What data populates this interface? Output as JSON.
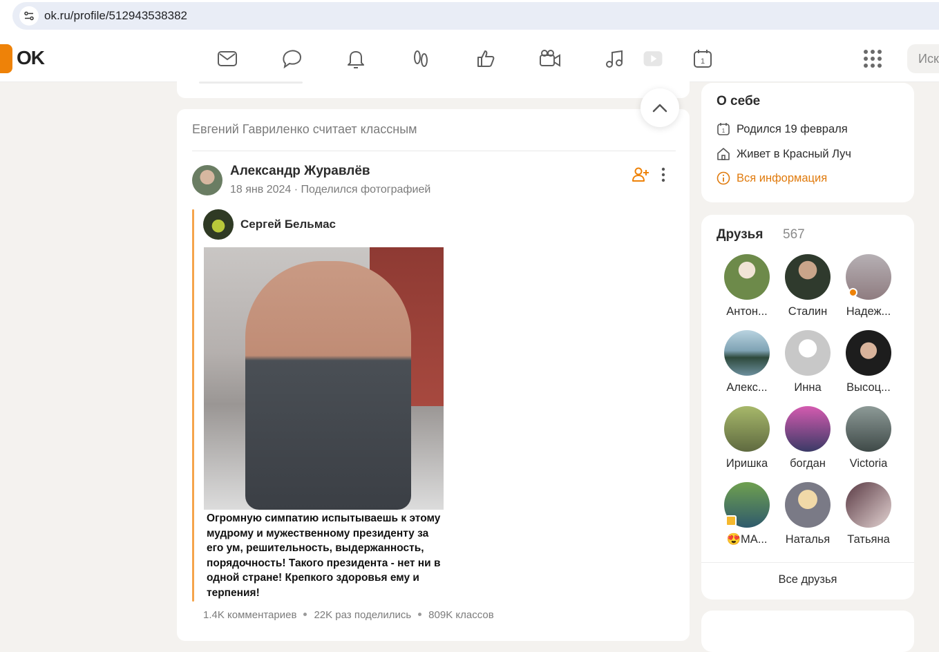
{
  "browser": {
    "url": "ok.ru/profile/512943538382"
  },
  "header": {
    "logo_text": "OK",
    "nav_icons": [
      "mail-icon",
      "discussions-icon",
      "notifications-icon",
      "guests-icon",
      "likes-icon",
      "video-call-icon",
      "music-icon",
      "video-icon",
      "calendar-icon"
    ],
    "search_placeholder": "Иск"
  },
  "feed": {
    "header": "Евгений Гавриленко считает классным",
    "post": {
      "author": "Александр Журавлёв",
      "date": "18 янв 2024",
      "action": "Поделился фотографией",
      "repost_author": "Сергей Бельмас",
      "caption": "Огромную симпатию испытываешь к этому мудрому и мужественному президенту за его ум, решительность, выдержанность, порядочность! Такого президента - нет ни в одной стране! Крепкого здоровья ему и терпения!",
      "stats": {
        "comments": "1.4K комментариев",
        "shares": "22K раз поделились",
        "likes": "809K классов"
      }
    }
  },
  "about": {
    "title": "О себе",
    "birthday": "Родился 19 февраля",
    "city": "Живет в Красный Луч",
    "all_info": "Вся информация"
  },
  "friends": {
    "title": "Друзья",
    "count": "567",
    "list": [
      {
        "name": "Антон..."
      },
      {
        "name": "Сталин"
      },
      {
        "name": "Надеж..."
      },
      {
        "name": "Алекс..."
      },
      {
        "name": "Инна"
      },
      {
        "name": "Высоц..."
      },
      {
        "name": "Иришка"
      },
      {
        "name": "богдан"
      },
      {
        "name": "Victoria"
      },
      {
        "name": "😍МА..."
      },
      {
        "name": "Наталья"
      },
      {
        "name": "Татьяна"
      }
    ],
    "all_label": "Все друзья"
  },
  "colors": {
    "brand": "#ee8208",
    "link": "#e07a0c",
    "background": "#f4f2ef"
  }
}
